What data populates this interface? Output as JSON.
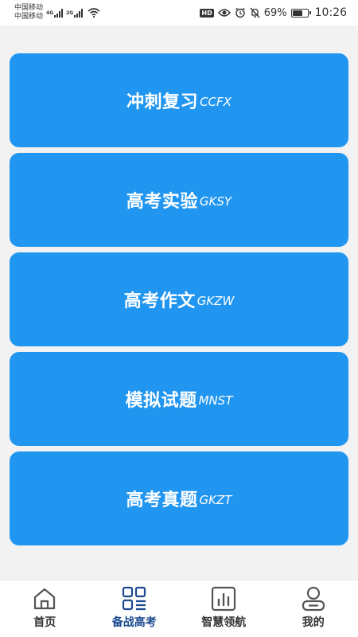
{
  "status_bar": {
    "carrier_1": "中国移动",
    "carrier_2": "中国移动",
    "net_1": "4G",
    "net_2": "2G",
    "hd": "HD",
    "battery_level_percent": 69,
    "battery_text": "69%",
    "time": "10:26"
  },
  "menu": {
    "color": "#2196f0",
    "items": [
      {
        "title": "冲刺复习",
        "code": "CCFX"
      },
      {
        "title": "高考实验",
        "code": "GKSY"
      },
      {
        "title": "高考作文",
        "code": "GKZW"
      },
      {
        "title": "模拟试题",
        "code": "MNST"
      },
      {
        "title": "高考真题",
        "code": "GKZT"
      }
    ]
  },
  "bottom_nav": {
    "active_color": "#1b4a8e",
    "inactive_color": "#555555",
    "items": [
      {
        "label": "首页",
        "icon": "home-icon",
        "active": false
      },
      {
        "label": "备战高考",
        "icon": "grid-list-icon",
        "active": true
      },
      {
        "label": "智慧领航",
        "icon": "bar-chart-icon",
        "active": false
      },
      {
        "label": "我的",
        "icon": "user-icon",
        "active": false
      }
    ]
  }
}
